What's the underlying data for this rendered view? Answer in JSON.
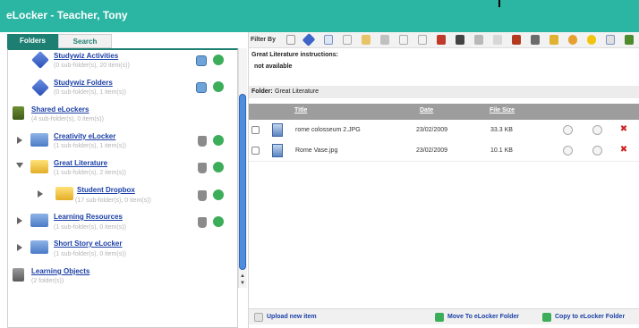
{
  "window": {
    "title": "eLocker - Teacher, Tony"
  },
  "tabs": [
    {
      "label": "Folders",
      "active": true
    },
    {
      "label": "Search",
      "active": false
    }
  ],
  "tree": [
    {
      "name": "Studywiz Activities",
      "sub": "(0 sub-folder(s), 20 item(s))",
      "icon": "diamond-icon"
    },
    {
      "name": "Studywiz Folders",
      "sub": "(0 sub-folder(s), 1 item(s))",
      "icon": "diamond-icon"
    },
    {
      "name": "Shared eLockers",
      "sub": "(4 sub-folder(s), 0 item(s))",
      "icon": "book-icon"
    },
    {
      "name": "Creativity eLocker",
      "sub": "(1 sub-folder(s), 1 item(s))",
      "icon": "folder-icon"
    },
    {
      "name": "Great Literature",
      "sub": "(1 sub-folder(s), 2 item(s))",
      "icon": "open-folder-icon"
    },
    {
      "name": "Student Dropbox",
      "sub": "(17 sub-folder(s), 0 item(s))",
      "icon": "dropbox-icon"
    },
    {
      "name": "Learning Resources",
      "sub": "(1 sub-folder(s), 0 item(s))",
      "icon": "folder-icon"
    },
    {
      "name": "Short Story eLocker",
      "sub": "(1 sub-folder(s), 0 item(s))",
      "icon": "folder-icon"
    },
    {
      "name": "Learning Objects",
      "sub": "(2 folder(s))",
      "icon": "book-icon"
    }
  ],
  "filter": {
    "label": "Filter By"
  },
  "instructions": {
    "title": "Great Literature instructions:",
    "text": "not available"
  },
  "folder_bar": {
    "label": "Folder:",
    "value": "Great Literature"
  },
  "table": {
    "headers": {
      "title": "Title",
      "date": "Date",
      "size": "File Size"
    },
    "rows": [
      {
        "title": "rome colosseum 2.JPG",
        "date": "23/02/2009",
        "size": "33.3 KB"
      },
      {
        "title": "Rome Vase.jpg",
        "date": "23/02/2009",
        "size": "10.1 KB"
      }
    ]
  },
  "bottom": {
    "upload": "Upload new item",
    "move": "Move To eLocker Folder",
    "copy": "Copy to eLocker Folder"
  },
  "colors": {
    "header": "#2bb5a3",
    "tab_active": "#1d7f72",
    "link": "#1a3fa6",
    "table_header": "#9d9d9d"
  }
}
